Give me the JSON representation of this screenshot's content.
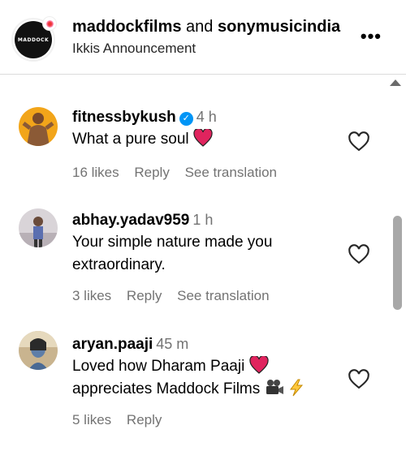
{
  "header": {
    "account_a": "maddockfilms",
    "joiner": "and",
    "account_b": "sonymusicindia",
    "subtitle": "Ikkis Announcement",
    "more": "•••",
    "logo_text": "MADDOCK"
  },
  "comments": [
    {
      "username": "fitnessbykush",
      "verified": true,
      "time": "4 h",
      "text": "What a pure soul",
      "emojis": [
        "red-heart"
      ],
      "likes": "16 likes",
      "reply": "Reply",
      "translate": "See translation"
    },
    {
      "username": "abhay.yadav959",
      "verified": false,
      "time": "1 h",
      "text": "Your simple nature made you extraordinary.",
      "likes": "3 likes",
      "reply": "Reply",
      "translate": "See translation"
    },
    {
      "username": "aryan.paaji",
      "verified": false,
      "time": "45 m",
      "text_line1": "Loved how Dharam Paaji",
      "text_line2": "appreciates Maddock Films",
      "emojis": [
        "red-heart",
        "movie-camera",
        "high-voltage"
      ],
      "likes": "5 likes",
      "reply": "Reply"
    }
  ],
  "colors": {
    "verified": "#0095f6",
    "secondary_text": "#737373",
    "heart_emoji": "#e0245e"
  }
}
